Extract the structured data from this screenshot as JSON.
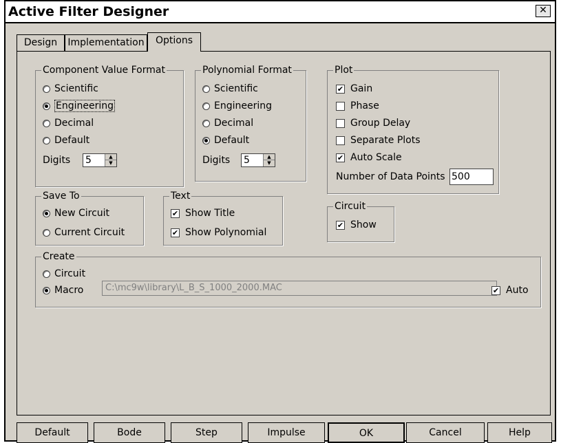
{
  "window": {
    "title": "Active Filter Designer",
    "close_glyph": "✕"
  },
  "tabs": [
    {
      "label": "Design",
      "active": false
    },
    {
      "label": "Implementation",
      "active": false
    },
    {
      "label": "Options",
      "active": true
    }
  ],
  "component_format": {
    "legend": "Component Value Format",
    "options": [
      "Scientific",
      "Engineering",
      "Decimal",
      "Default"
    ],
    "selected": "Engineering",
    "digits_label": "Digits",
    "digits_value": "5"
  },
  "polynomial_format": {
    "legend": "Polynomial Format",
    "options": [
      "Scientific",
      "Engineering",
      "Decimal",
      "Default"
    ],
    "selected": "Default",
    "digits_label": "Digits",
    "digits_value": "5"
  },
  "plot": {
    "legend": "Plot",
    "items": [
      {
        "label": "Gain",
        "checked": true
      },
      {
        "label": "Phase",
        "checked": false
      },
      {
        "label": "Group Delay",
        "checked": false
      },
      {
        "label": "Separate Plots",
        "checked": false
      },
      {
        "label": "Auto Scale",
        "checked": true
      }
    ],
    "data_points_label": "Number of Data Points",
    "data_points_value": "500"
  },
  "save_to": {
    "legend": "Save To",
    "options": [
      "New Circuit",
      "Current Circuit"
    ],
    "selected": "New Circuit"
  },
  "text": {
    "legend": "Text",
    "items": [
      {
        "label": "Show Title",
        "checked": true
      },
      {
        "label": "Show Polynomial",
        "checked": true
      }
    ]
  },
  "circuit": {
    "legend": "Circuit",
    "items": [
      {
        "label": "Show",
        "checked": true
      }
    ]
  },
  "create": {
    "legend": "Create",
    "options": [
      "Circuit",
      "Macro"
    ],
    "selected": "Macro",
    "macro_path": "C:\\mc9w\\library\\L_B_S_1000_2000.MAC",
    "auto_label": "Auto",
    "auto_checked": true
  },
  "buttons": [
    "Default",
    "Bode",
    "Step",
    "Impulse",
    "OK",
    "Cancel",
    "Help"
  ],
  "icons": {
    "check": "✔",
    "spin_up": "▲",
    "spin_down": "▼"
  }
}
